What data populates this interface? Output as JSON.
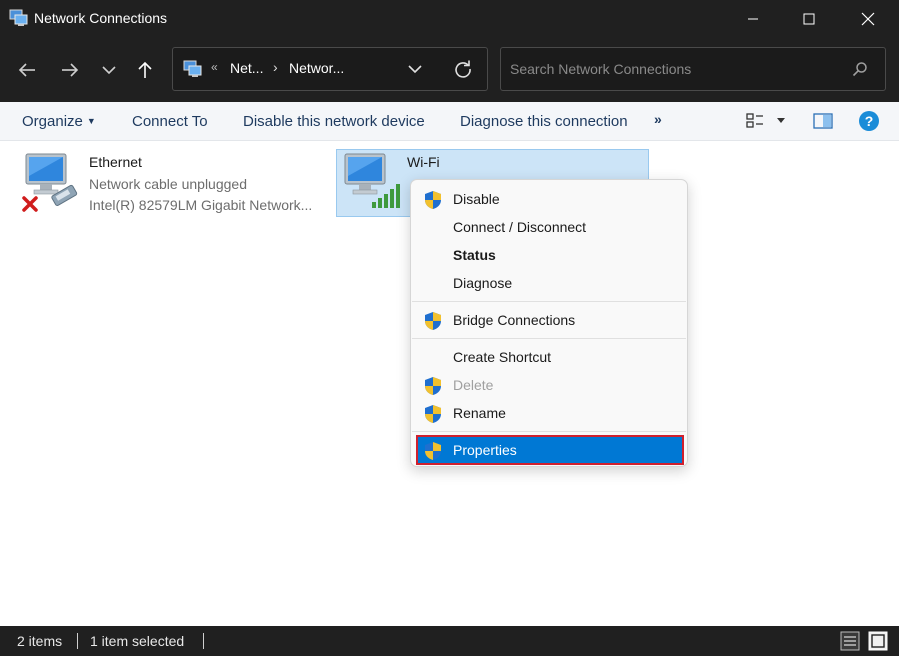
{
  "window": {
    "title": "Network Connections"
  },
  "address": {
    "overflow": "«",
    "crumbs": [
      "Net...",
      "Networ..."
    ],
    "separator": "›"
  },
  "search": {
    "placeholder": "Search Network Connections"
  },
  "commandbar": {
    "organize": "Organize",
    "connect_to": "Connect To",
    "disable_device": "Disable this network device",
    "diagnose": "Diagnose this connection",
    "more": "»"
  },
  "items": [
    {
      "name": "Ethernet",
      "status": "Network cable unplugged",
      "device": "Intel(R) 82579LM Gigabit Network..."
    },
    {
      "name": "Wi-Fi"
    }
  ],
  "context_menu": {
    "items": [
      {
        "label": "Disable",
        "shield": true
      },
      {
        "label": "Connect / Disconnect",
        "shield": false
      },
      {
        "label": "Status",
        "shield": false,
        "bold": true
      },
      {
        "label": "Diagnose",
        "shield": false
      },
      {
        "label": "Bridge Connections",
        "shield": true
      },
      {
        "label": "Create Shortcut",
        "shield": false
      },
      {
        "label": "Delete",
        "shield": true,
        "disabled": true
      },
      {
        "label": "Rename",
        "shield": true
      },
      {
        "label": "Properties",
        "shield": true,
        "highlighted": true
      }
    ]
  },
  "statusbar": {
    "item_count": "2 items",
    "selected": "1 item selected"
  },
  "colors": {
    "titlebar_bg": "#202020",
    "selection_bg": "#cce4f7",
    "highlight": "#0078d4",
    "highlight_outline": "#d0202e",
    "help_icon": "#1a8cd8"
  },
  "icons": [
    "network-connections-icon",
    "back-arrow-icon",
    "forward-arrow-icon",
    "recent-chevron-icon",
    "up-arrow-icon",
    "refresh-icon",
    "search-icon",
    "view-options-icon",
    "preview-pane-icon",
    "help-icon",
    "uac-shield-icon",
    "ethernet-adapter-icon",
    "wifi-adapter-icon",
    "details-view-icon",
    "large-icons-view-icon"
  ]
}
